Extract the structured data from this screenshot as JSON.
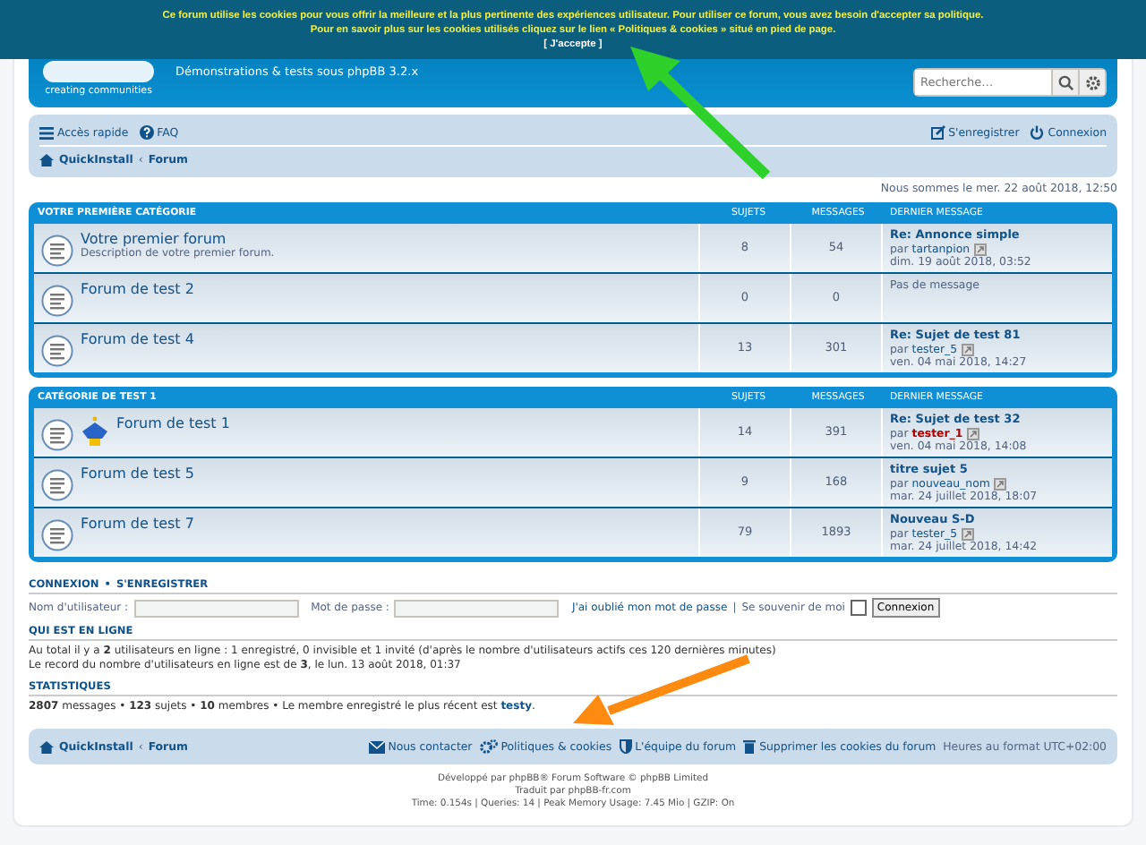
{
  "cookie_banner": {
    "lines": [
      "Ce forum utilise les cookies pour vous offrir la meilleure et la plus pertinente des expériences utilisateur. Pour utiliser ce forum, vous avez besoin d'accepter sa politique.",
      "Pour en savoir plus sur les cookies utilisés cliquez sur le lien « Politiques & cookies » situé en pied de page."
    ],
    "accept": "[ J'accepte ]"
  },
  "header": {
    "logo_caption": "creating communities",
    "tagline": "Démonstrations & tests sous phpBB 3.2.x",
    "search": {
      "placeholder": "Recherche…"
    }
  },
  "navbar": {
    "left": [
      {
        "kind": "menu",
        "label": "Accès rapide"
      },
      {
        "kind": "help",
        "label": "FAQ"
      }
    ],
    "right": [
      {
        "kind": "register",
        "label": "S'enregistrer"
      },
      {
        "kind": "login",
        "label": "Connexion"
      }
    ],
    "breadcrumb": [
      "QuickInstall",
      "Forum"
    ],
    "breadcrumb_separator": "‹"
  },
  "date": "Nous sommes le mer. 22 août 2018, 12:50",
  "categories": [
    {
      "title": "VOTRE PREMIÈRE CATÉGORIE",
      "columns": [
        "SUJETS",
        "MESSAGES",
        "DERNIER MESSAGE"
      ],
      "forums": [
        {
          "name": "Votre premier forum",
          "description": "Description de votre premier forum.",
          "has_image": false,
          "topics": "8",
          "posts": "54",
          "last": {
            "title": "Re: Annonce simple",
            "by": "par",
            "author": "tartanpion",
            "date": "dim. 19 août 2018, 03:52"
          }
        },
        {
          "name": "Forum de test 2",
          "has_image": false,
          "topics": "0",
          "posts": "0",
          "no_post": "Pas de message"
        },
        {
          "name": "Forum de test 4",
          "has_image": false,
          "topics": "13",
          "posts": "301",
          "last": {
            "title": "Re: Sujet de test 81",
            "by": "par",
            "author": "tester_5",
            "date": "ven. 04 mai 2018, 14:27"
          }
        }
      ]
    },
    {
      "title": "CATÉGORIE DE TEST 1",
      "columns": [
        "SUJETS",
        "MESSAGES",
        "DERNIER MESSAGE"
      ],
      "forums": [
        {
          "name": "Forum de test 1",
          "has_image": true,
          "topics": "14",
          "posts": "391",
          "last": {
            "title": "Re: Sujet de test 32",
            "by": "par",
            "author": "tester_1",
            "color": "#aa0000",
            "date": "ven. 04 mai 2018, 14:08"
          }
        },
        {
          "name": "Forum de test 5",
          "has_image": false,
          "topics": "9",
          "posts": "168",
          "last": {
            "title": "titre sujet 5",
            "by": "par",
            "author": "nouveau_nom",
            "date": "mar. 24 juillet 2018, 18:07"
          }
        },
        {
          "name": "Forum de test 7",
          "has_image": false,
          "topics": "79",
          "posts": "1893",
          "last": {
            "title": "Nouveau S-D",
            "by": "par",
            "author": "tester_5",
            "date": "mar. 24 juillet 2018, 14:42"
          }
        }
      ]
    }
  ],
  "login": {
    "heading": [
      "CONNEXION",
      "•",
      "S'ENREGISTRER"
    ],
    "username_label": "Nom d'utilisateur :",
    "password_label": "Mot de passe :",
    "forgot": "J'ai oublié mon mot de passe",
    "separator": "|",
    "remember": "Se souvenir de moi",
    "remember_checked": false,
    "button": "Connexion"
  },
  "online": {
    "heading": "QUI EST EN LIGNE",
    "lines": [
      "Au total il y a **2** utilisateurs en ligne : 1 enregistré, 0 invisible et 1 invité (d'après le nombre d'utilisateurs actifs ces 120 dernières minutes)",
      "Le record du nombre d'utilisateurs en ligne est de **3**, le lun. 13 août 2018, 01:37"
    ]
  },
  "stats": {
    "heading": "STATISTIQUES",
    "text": "**2807** messages • **123** sujets • **10** membres • Le membre enregistré le plus récent est ",
    "newest": "testy",
    "end": "."
  },
  "footer_nav": {
    "breadcrumb": [
      "QuickInstall",
      "Forum"
    ],
    "breadcrumb_separator": "‹",
    "links": [
      {
        "kind": "contact",
        "label": "Nous contacter"
      },
      {
        "kind": "policy",
        "label": "Politiques & cookies"
      },
      {
        "kind": "team",
        "label": "L'équipe du forum"
      },
      {
        "kind": "delete",
        "label": "Supprimer les cookies du forum"
      }
    ],
    "timezone": "Heures au format UTC+02:00"
  },
  "credits": [
    "Développé par phpBB® Forum Software © phpBB Limited",
    "Traduit par phpBB-fr.com",
    "Time: 0.154s | Queries: 14 | Peak Memory Usage: 7.45 Mio | GZIP: On"
  ]
}
